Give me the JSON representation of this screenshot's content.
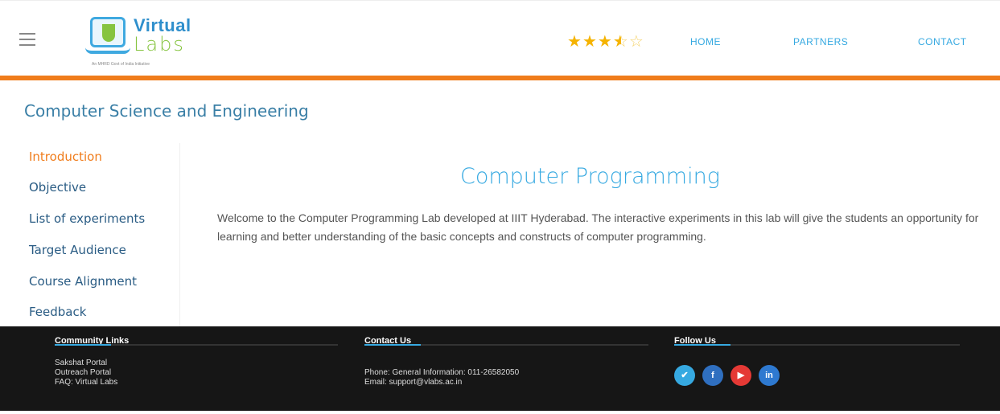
{
  "header": {
    "logo": {
      "title": "Virtual",
      "subtitle": "Labs",
      "tagline": "An MHRD Govt of India Initiative"
    },
    "rating": {
      "value": 3.5,
      "max": 5
    },
    "nav": {
      "home": "HOME",
      "partners": "PARTNERS",
      "contact": "CONTACT"
    },
    "colors": {
      "accent": "#f07c1b",
      "link": "#36a9e1"
    }
  },
  "main": {
    "department": "Computer Science and Engineering",
    "sidebar": {
      "items": [
        {
          "label": "Introduction",
          "active": true
        },
        {
          "label": "Objective",
          "active": false
        },
        {
          "label": "List of experiments",
          "active": false
        },
        {
          "label": "Target Audience",
          "active": false
        },
        {
          "label": "Course Alignment",
          "active": false
        },
        {
          "label": "Feedback",
          "active": false
        }
      ]
    },
    "title": "Computer Programming",
    "description": "Welcome to the Computer Programming Lab developed at IIIT Hyderabad. The interactive experiments in this lab will give the students an opportunity for learning and better understanding of the basic concepts and constructs of computer programming."
  },
  "footer": {
    "community": {
      "heading": "Community Links",
      "links": [
        "Sakshat Portal",
        "Outreach Portal",
        "FAQ: Virtual Labs"
      ]
    },
    "contact": {
      "heading": "Contact Us",
      "phone": "Phone: General Information: 011-26582050",
      "email": "Email: support@vlabs.ac.in"
    },
    "follow": {
      "heading": "Follow Us",
      "icons": [
        "twitter-icon",
        "facebook-icon",
        "youtube-icon",
        "linkedin-icon"
      ]
    }
  }
}
